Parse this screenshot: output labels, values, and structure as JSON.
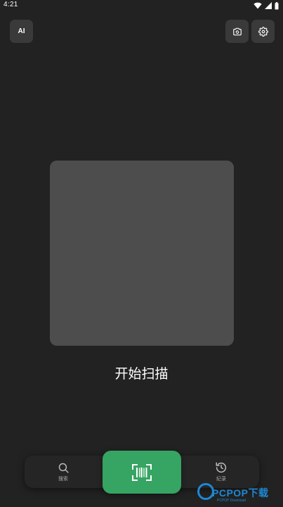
{
  "status_bar": {
    "time": "4:21"
  },
  "header": {
    "ai_label": "AI",
    "camera_icon": "camera-switch-icon",
    "settings_icon": "gear-icon"
  },
  "main": {
    "start_label": "开始扫描"
  },
  "bottom_nav": {
    "search_label": "搜索",
    "history_label": "纪录",
    "scan_icon": "barcode-scan-icon"
  },
  "watermark": {
    "brand": "PCPOP下载",
    "sub": "PCPOP Download"
  },
  "colors": {
    "background": "#222222",
    "accent": "#36a462",
    "button": "#3a3a3a",
    "preview": "#4d4d4d",
    "watermark": "#1e88d4"
  }
}
